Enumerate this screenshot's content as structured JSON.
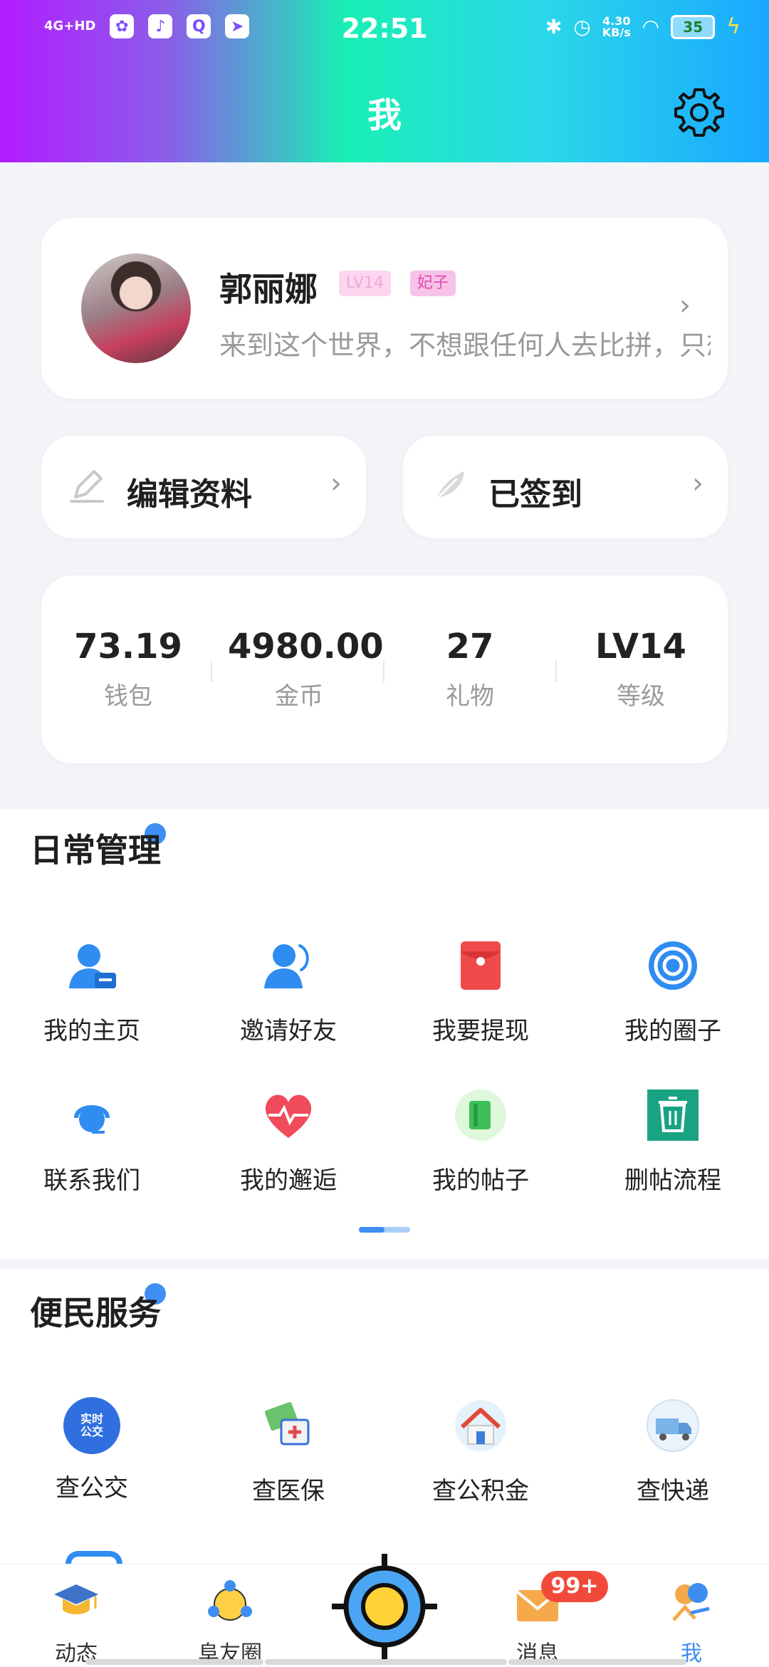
{
  "status_bar": {
    "time": "22:51",
    "network": "4G+HD",
    "speed_top": "4.30",
    "speed_bottom": "KB/s",
    "battery": "35"
  },
  "header": {
    "title": "我"
  },
  "profile": {
    "name": "郭丽娜",
    "level_tag": "LV14",
    "role_tag": "妃子",
    "signature": "来到这个世界，不想跟任何人去比拼，只想"
  },
  "actions": {
    "edit_label": "编辑资料",
    "signin_label": "已签到"
  },
  "stats": [
    {
      "value": "73.19",
      "label": "钱包"
    },
    {
      "value": "4980.00",
      "label": "金币"
    },
    {
      "value": "27",
      "label": "礼物"
    },
    {
      "value": "LV14",
      "label": "等级"
    }
  ],
  "daily": {
    "title": "日常管理",
    "items": [
      {
        "label": "我的主页",
        "icon": "user-home-icon"
      },
      {
        "label": "邀请好友",
        "icon": "invite-friend-icon"
      },
      {
        "label": "我要提现",
        "icon": "red-envelope-icon"
      },
      {
        "label": "我的圈子",
        "icon": "circle-icon"
      },
      {
        "label": "联系我们",
        "icon": "headset-icon"
      },
      {
        "label": "我的邂逅",
        "icon": "heart-pulse-icon"
      },
      {
        "label": "我的帖子",
        "icon": "book-icon"
      },
      {
        "label": "删帖流程",
        "icon": "trash-icon"
      }
    ],
    "page_index": 1,
    "page_count": 2
  },
  "service": {
    "title": "便民服务",
    "items": [
      {
        "label": "查公交",
        "icon": "bus-icon",
        "icon_text": "实时公交"
      },
      {
        "label": "查医保",
        "icon": "medical-insurance-icon"
      },
      {
        "label": "查公积金",
        "icon": "house-icon"
      },
      {
        "label": "查快递",
        "icon": "delivery-truck-icon"
      }
    ]
  },
  "tabbar": {
    "items": [
      {
        "label": "动态",
        "icon": "graduation-cap-icon"
      },
      {
        "label": "阜友圈",
        "icon": "friends-circle-icon"
      },
      {
        "label": "消息",
        "icon": "message-icon"
      },
      {
        "label": "我",
        "icon": "me-icon"
      }
    ],
    "message_badge": "99+"
  },
  "colors": {
    "accent": "#3e8ef5",
    "badge": "#f24a3a",
    "tag_pink": "#e14bb2"
  }
}
